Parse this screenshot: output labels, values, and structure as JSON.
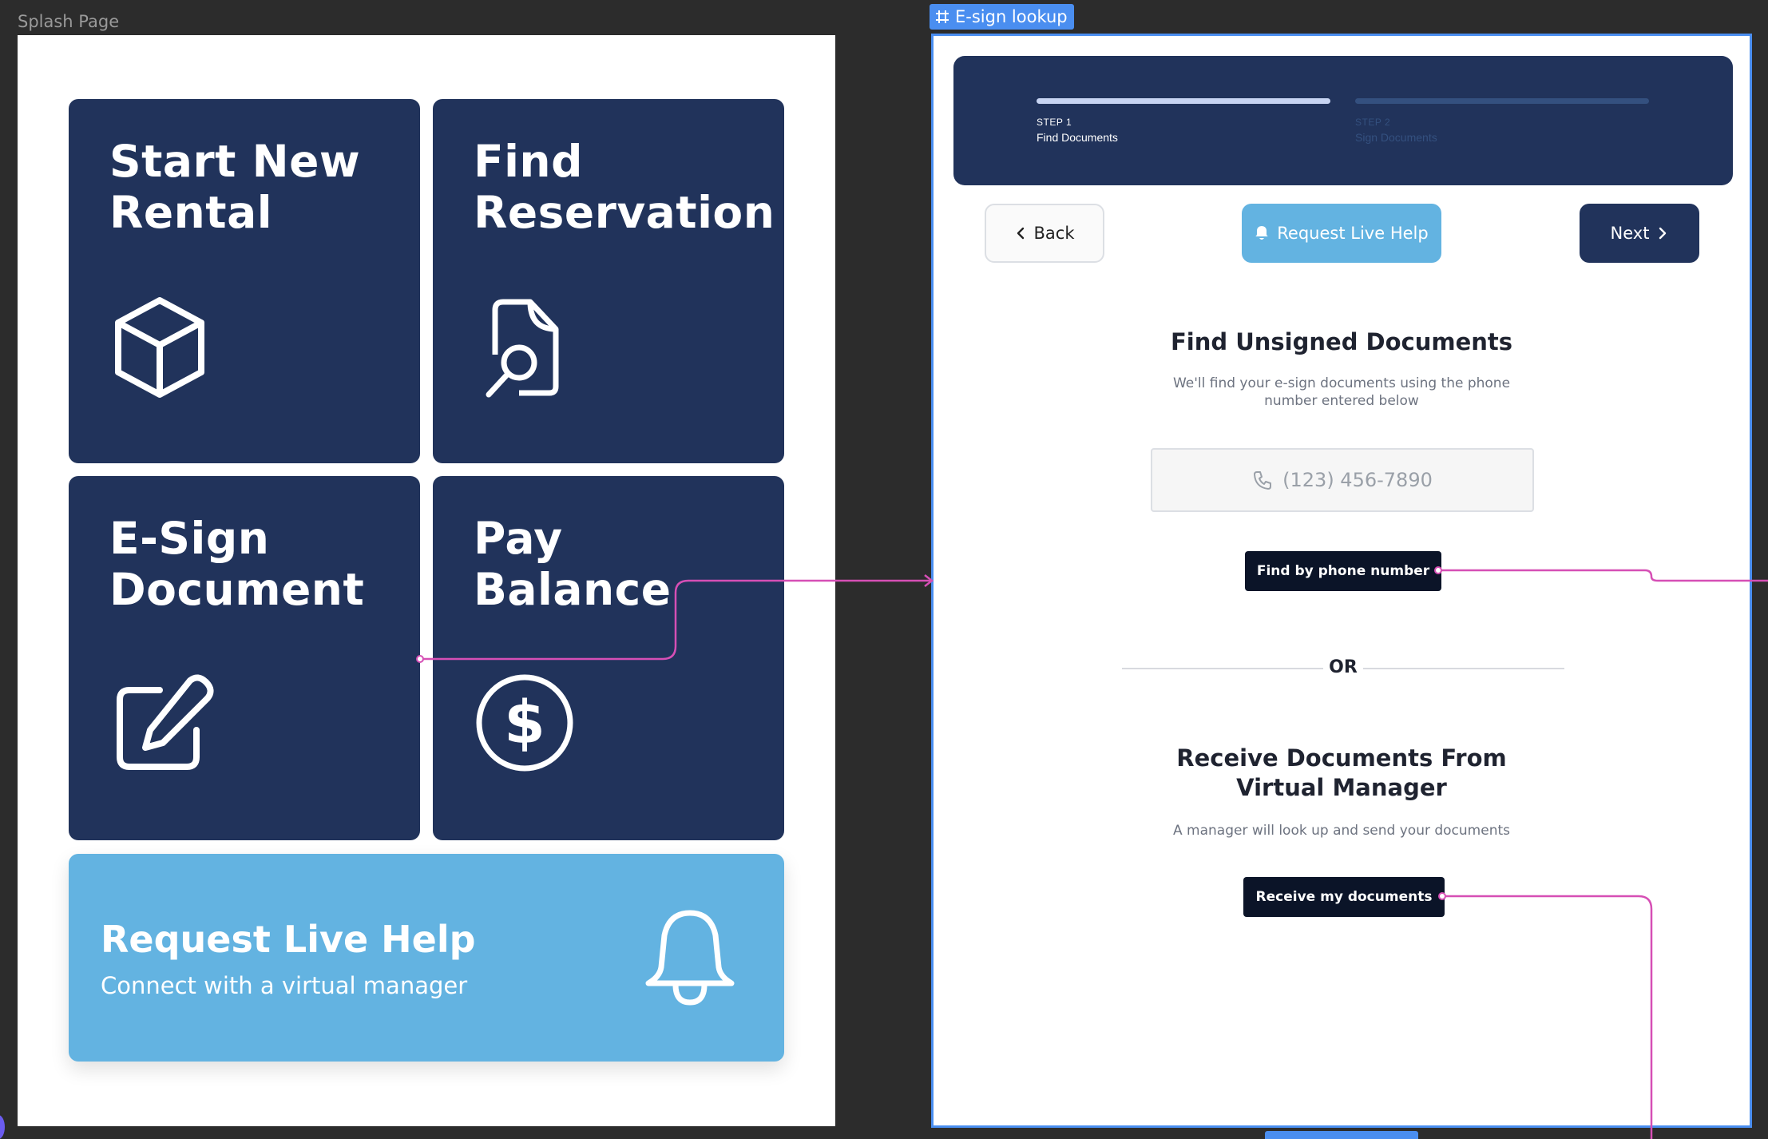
{
  "frames": {
    "splash_label": "Splash Page",
    "esign_tag": "E-sign lookup"
  },
  "splash": {
    "tiles": [
      {
        "title": "Start New\nRental",
        "icon": "cube-icon"
      },
      {
        "title": "Find\nReservation",
        "icon": "document-search-icon"
      },
      {
        "title": "E-Sign\nDocument",
        "icon": "edit-icon"
      },
      {
        "title": "Pay\nBalance",
        "icon": "dollar-circle-icon"
      }
    ],
    "help": {
      "title": "Request Live Help",
      "subtitle": "Connect with a virtual manager",
      "icon": "bell-icon"
    }
  },
  "esign": {
    "steps": [
      {
        "label": "STEP 1",
        "name": "Find Documents",
        "active": true
      },
      {
        "label": "STEP 2",
        "name": "Sign Documents",
        "active": false
      }
    ],
    "nav": {
      "back": "Back",
      "help": "Request Live Help",
      "next": "Next"
    },
    "find": {
      "title": "Find Unsigned Documents",
      "description": "We'll find your e-sign documents using the phone\nnumber entered below",
      "phone_placeholder": "(123) 456-7890",
      "button": "Find by phone number"
    },
    "or": "OR",
    "receive": {
      "title": "Receive Documents From\nVirtual Manager",
      "description": "A manager will look up and send your documents",
      "button": "Receive my documents"
    }
  },
  "colors": {
    "tile_navy": "#21335b",
    "help_blue": "#63b3e1",
    "dark_button": "#0b1428",
    "connector": "#d64fb5",
    "frame_select": "#4a8ef0"
  }
}
